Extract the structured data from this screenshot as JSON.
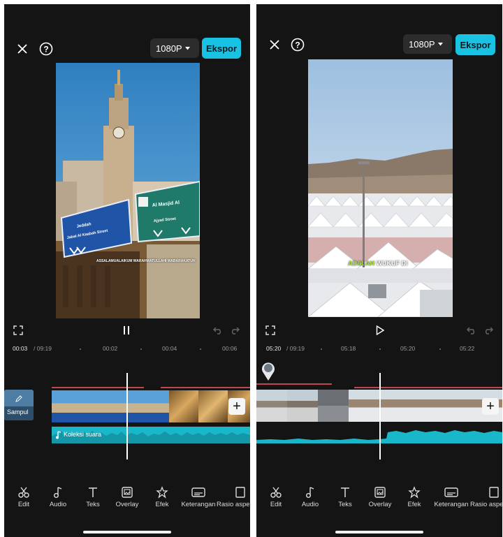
{
  "left": {
    "resolution": "1080P",
    "export_label": "Ekspor",
    "timecode_current": "00:03",
    "timecode_total": "/ 09:19",
    "ruler_marks": [
      "00:02",
      "00:04",
      "00:06"
    ],
    "cover_label": "Sampul",
    "audio_label": "Koleksi suara",
    "video_caption": "ASSALAMUALAIKUM WARAHMATULLAHI WABARAKATUH"
  },
  "right": {
    "resolution": "1080P",
    "export_label": "Ekspor",
    "timecode_current": "05:20",
    "timecode_total": "/ 09:19",
    "ruler_marks": [
      "05:18",
      "05:20",
      "05:22"
    ],
    "caption_highlight": "ADALAH",
    "caption_rest": "WUKUF DI"
  },
  "toolbar": [
    "Edit",
    "Audio",
    "Teks",
    "Overlay",
    "Efek",
    "Keterangan",
    "Rasio aspek"
  ],
  "signs": {
    "left_sign": [
      "Jeddah",
      "Jabal Al Kaabah Street"
    ],
    "right_sign": [
      "Al Masjid Al",
      "Ajyad Street"
    ]
  },
  "colors": {
    "accent": "#19c2e3",
    "audio": "#1ab6c9",
    "background": "#141414"
  }
}
